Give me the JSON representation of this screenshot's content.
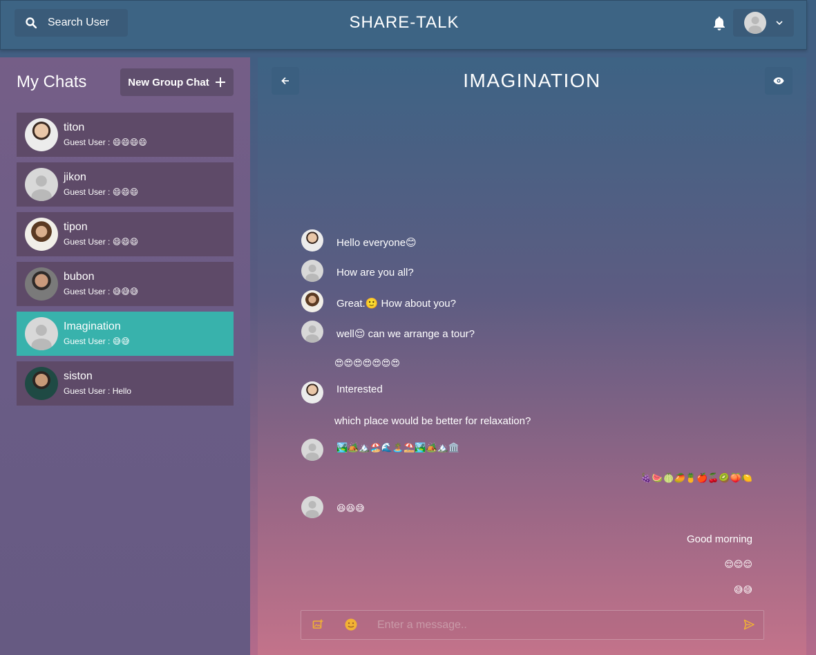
{
  "header": {
    "search_label": "Search User",
    "app_title": "SHARE-TALK"
  },
  "sidebar": {
    "title": "My Chats",
    "new_group_label": "New Group Chat",
    "chats": [
      {
        "name": "titon",
        "preview": "Guest User : 😄😄😄😄",
        "avatar": "photo"
      },
      {
        "name": "jikon",
        "preview": "Guest User : 😄😄😄",
        "avatar": "generic"
      },
      {
        "name": "tipon",
        "preview": "Guest User : 😄😄😄",
        "avatar": "photo"
      },
      {
        "name": "bubon",
        "preview": "Guest User : 😅😅😅",
        "avatar": "photo"
      },
      {
        "name": "Imagination",
        "preview": "Guest User : 😅😅",
        "avatar": "generic",
        "active": true
      },
      {
        "name": "siston",
        "preview": "Guest User : Hello",
        "avatar": "photo"
      }
    ]
  },
  "chat": {
    "title": "IMAGINATION",
    "messages": [
      {
        "text": "Hello everyone😊",
        "side": "left",
        "avatar": "photo"
      },
      {
        "text": "How are you all?",
        "side": "left",
        "avatar": "generic"
      },
      {
        "text": "Great.🙂 How about you?",
        "side": "left",
        "avatar": "photo"
      },
      {
        "text": "well😌 can we arrange a tour?",
        "side": "left",
        "avatar": "generic"
      },
      {
        "text": "😍😍😍😍😍😍😍",
        "side": "left",
        "avatar": "none"
      },
      {
        "text": "Interested",
        "side": "left",
        "avatar": "photo"
      },
      {
        "text": "which place would be better for relaxation?",
        "side": "left",
        "avatar": "none"
      },
      {
        "text": "🏞️🏕️🏔️🏖️🌊🏝️⛱️🏞️🏕️🏔️🏛️",
        "side": "left",
        "avatar": "generic"
      },
      {
        "text": "🍇🍉🍈🥭🍍🍎🍒🥝🍑🍋",
        "side": "right",
        "avatar": "none"
      },
      {
        "text": "😆😆😅",
        "side": "left",
        "avatar": "generic"
      },
      {
        "text": "Good morning",
        "side": "right",
        "avatar": "none"
      },
      {
        "text": "😌😌😌",
        "side": "right",
        "avatar": "none"
      },
      {
        "text": "😅😅",
        "side": "right",
        "avatar": "none"
      }
    ],
    "input_placeholder": "Enter a message.."
  },
  "colors": {
    "active_chat": "#38b2ac",
    "accent_icon": "#f2b233"
  }
}
